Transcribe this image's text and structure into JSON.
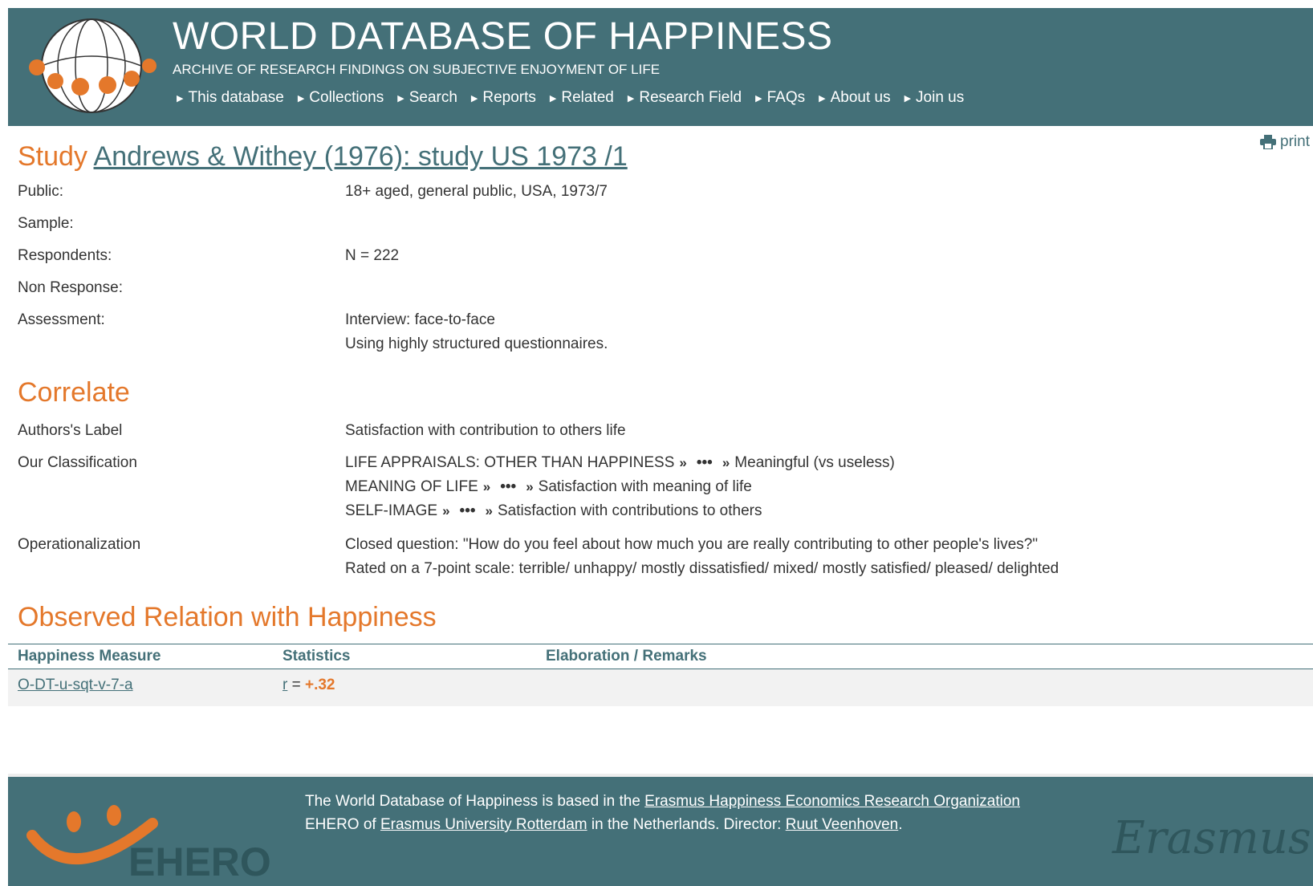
{
  "header": {
    "title": "WORLD DATABASE OF HAPPINESS",
    "subtitle": "ARCHIVE OF RESEARCH FINDINGS ON SUBJECTIVE ENJOYMENT OF LIFE",
    "nav": [
      "This database",
      "Collections",
      "Search",
      "Reports",
      "Related",
      "Research Field",
      "FAQs",
      "About us",
      "Join us"
    ]
  },
  "print_label": "print",
  "study": {
    "heading": "Study",
    "link": "Andrews & Withey (1976): study US 1973 /1",
    "rows": [
      {
        "label": "Public:",
        "value": "18+ aged, general public, USA, 1973/7"
      },
      {
        "label": "Sample:",
        "value": ""
      },
      {
        "label": "Respondents:",
        "value": "N = 222"
      },
      {
        "label": "Non Response:",
        "value": ""
      },
      {
        "label": "Assessment:",
        "value": "Interview: face-to-face",
        "value2": "Using highly structured questionnaires."
      }
    ]
  },
  "correlate": {
    "heading": "Correlate",
    "authors_label": "Authors's Label",
    "authors_value": "Satisfaction with contribution to others life",
    "classification_label": "Our Classification",
    "classifications": [
      {
        "main": "LIFE APPRAISALS: OTHER THAN HAPPINESS",
        "sub": "Meaningful (vs useless)"
      },
      {
        "main": "MEANING OF LIFE",
        "sub": "Satisfaction with meaning of life"
      },
      {
        "main": "SELF-IMAGE",
        "sub": "Satisfaction with contributions to others"
      }
    ],
    "operationalization_label": "Operationalization",
    "operationalization_1": "Closed question: \"How do you feel about how much you are really contributing to other people's lives?\"",
    "operationalization_2": "Rated on a 7-point scale: terrible/ unhappy/ mostly dissatisfied/ mixed/ mostly satisfied/ pleased/ delighted"
  },
  "observed": {
    "heading": "Observed Relation with Happiness",
    "columns": [
      "Happiness Measure",
      "Statistics",
      "Elaboration / Remarks"
    ],
    "row": {
      "measure": "O-DT-u-sqt-v-7-a",
      "stat_symbol": "r",
      "stat_eq": " = ",
      "stat_value": "+.32",
      "remarks": ""
    }
  },
  "footer": {
    "line1_prefix": "The World Database of Happiness is based in the ",
    "line1_link": "Erasmus Happiness Economics Research Organization",
    "line2_prefix": "EHERO of ",
    "line2_link": "Erasmus University Rotterdam",
    "line2_mid": " in the Netherlands. Director: ",
    "line2_link2": "Ruut Veenhoven",
    "line2_end": ".",
    "ehero_logo_text": "EHERO",
    "erasmus_logo_text": "Erasmus"
  },
  "colors": {
    "teal": "#447078",
    "orange": "#e4782b"
  }
}
